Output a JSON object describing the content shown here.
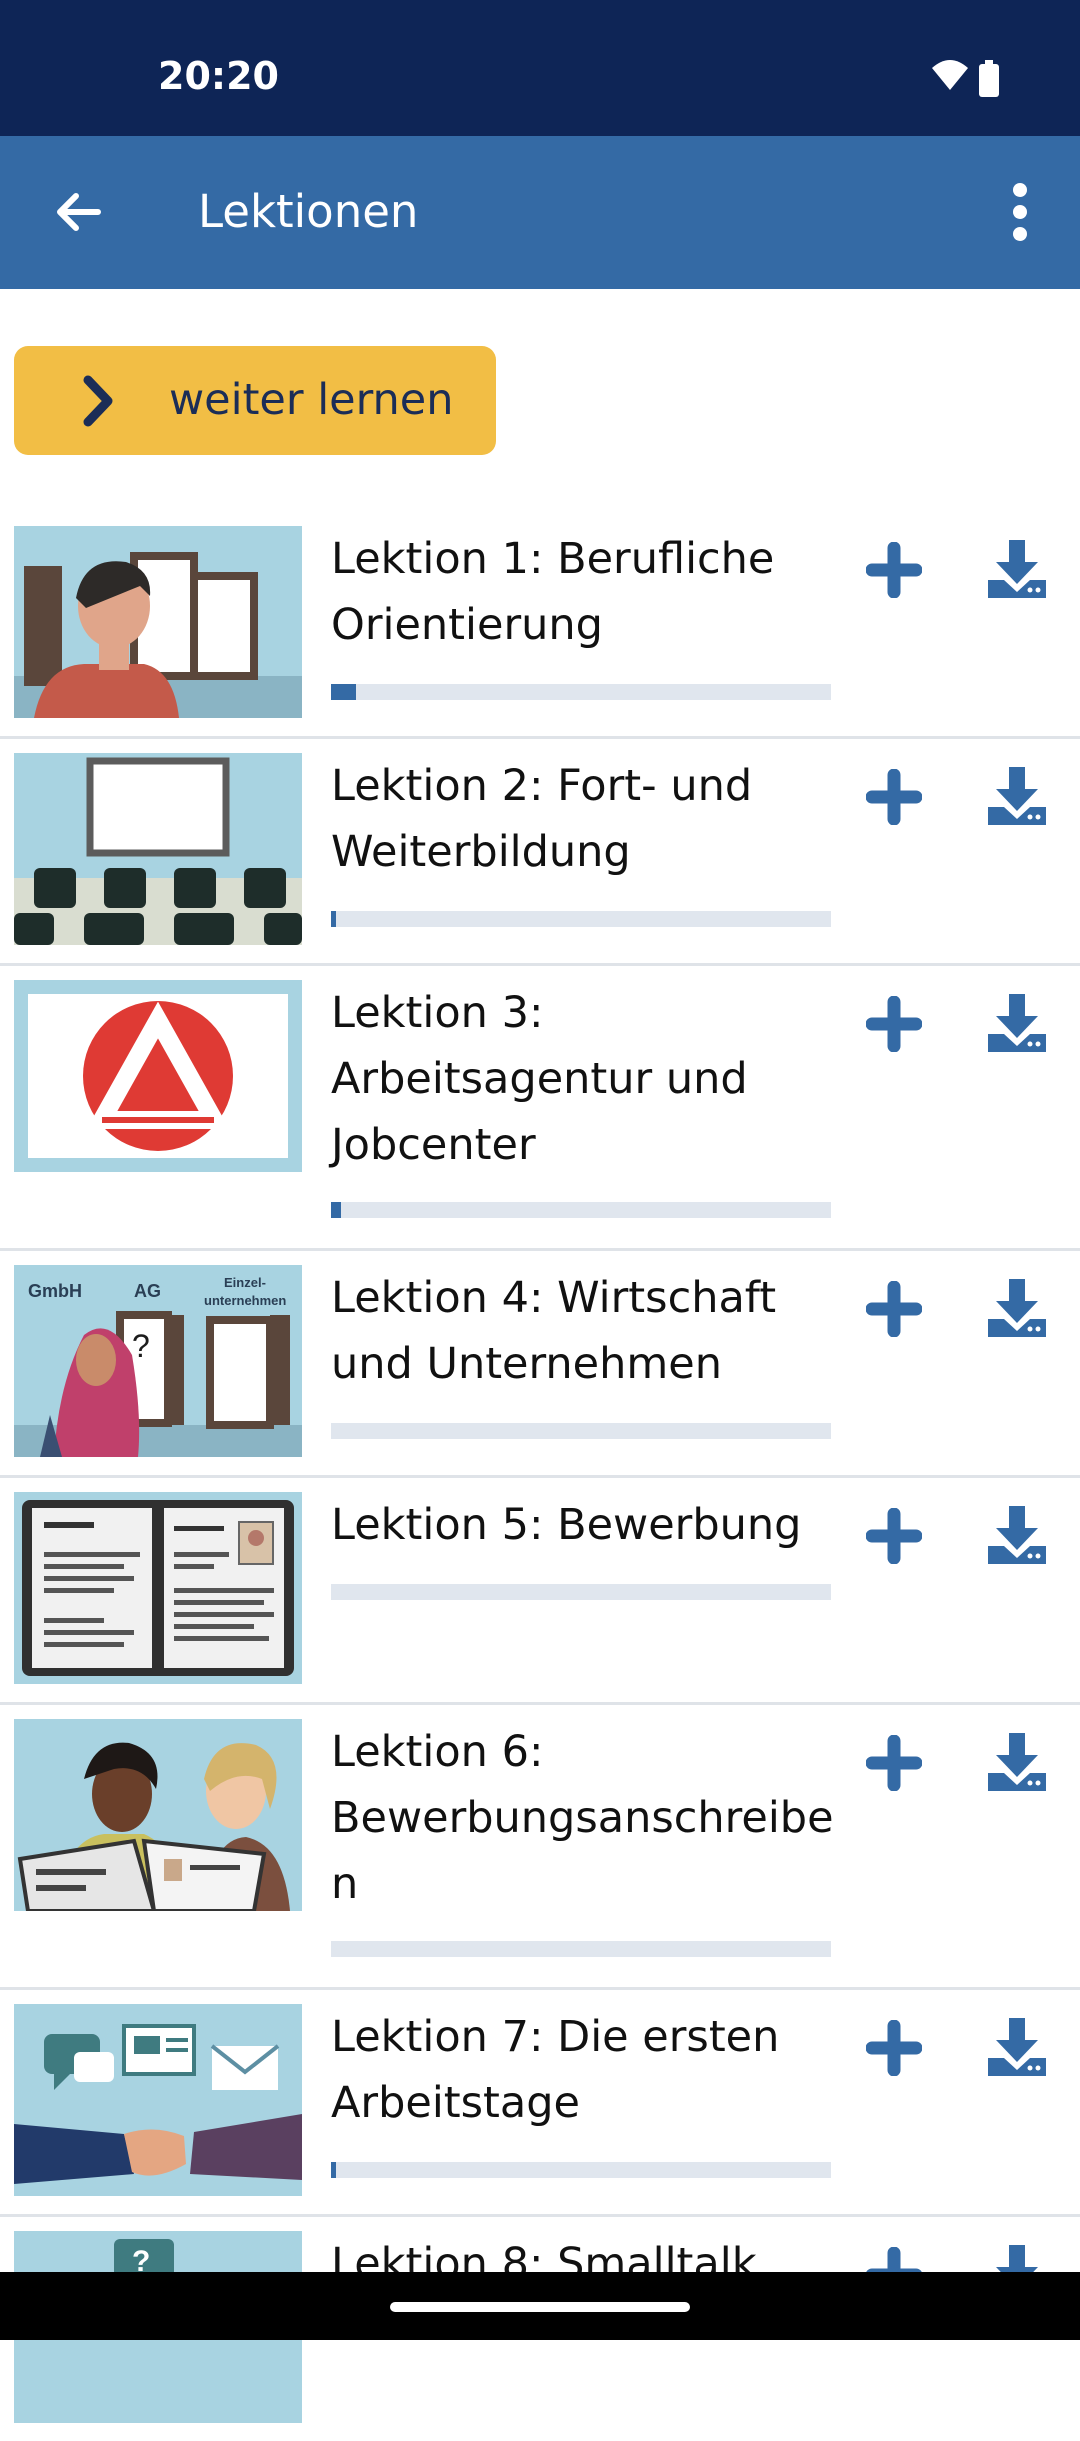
{
  "status_bar": {
    "time": "20:20"
  },
  "app_bar": {
    "title": "Lektionen"
  },
  "continue_button": {
    "label": "weiter lernen",
    "color": "#f2be45"
  },
  "colors": {
    "primary": "#346aa5",
    "status": "#0e2556",
    "progress_track": "#e0e6ee"
  },
  "lessons": [
    {
      "title": "Lektion 1: Berufliche Orientierung",
      "progress": 0.05
    },
    {
      "title": "Lektion 2: Fort- und Weiterbildung",
      "progress": 0.01
    },
    {
      "title": "Lektion 3: Arbeitsagentur und Jobcenter",
      "progress": 0.02
    },
    {
      "title": "Lektion 4: Wirtschaft und Unternehmen",
      "progress": 0
    },
    {
      "title": "Lektion 5: Bewerbung",
      "progress": 0
    },
    {
      "title": "Lektion 6: Bewerbungsanschreibe n",
      "progress": 0
    },
    {
      "title": "Lektion 7: Die ersten Arbeitstage",
      "progress": 0.01
    },
    {
      "title": "Lektion 8: Smalltalk",
      "progress": 0
    }
  ],
  "thumbnail_texts": {
    "gmbh": "GmbH",
    "ag": "AG",
    "einzel": "Einzel-",
    "unternehmen": "unternehmen",
    "question": "?"
  },
  "icons": [
    "arrow-back-icon",
    "more-vert-icon",
    "chevron-right-icon",
    "plus-icon",
    "download-icon",
    "wifi-icon",
    "battery-icon"
  ]
}
